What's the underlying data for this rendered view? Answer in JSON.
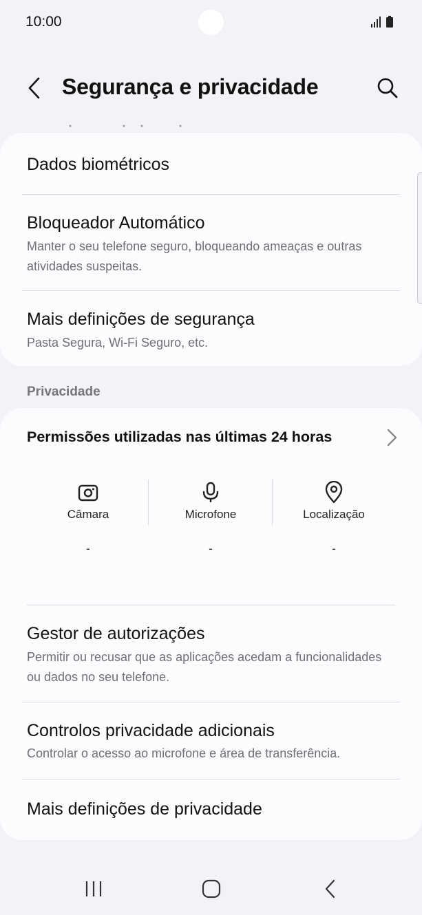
{
  "status_bar": {
    "time": "10:00"
  },
  "header": {
    "title": "Segurança e privacidade"
  },
  "security_card": {
    "items": [
      {
        "title": "Dados biométricos"
      },
      {
        "title": "Bloqueador Automático",
        "subtitle": "Manter o seu telefone seguro, bloqueando ameaças e outras atividades suspeitas."
      },
      {
        "title": "Mais definições de segurança",
        "subtitle": "Pasta Segura, Wi-Fi Seguro, etc."
      }
    ]
  },
  "privacy": {
    "section_label": "Privacidade",
    "permissions_title": "Permissões utilizadas nas últimas 24 horas",
    "permissions": [
      {
        "label": "Câmara",
        "icon": "camera-icon",
        "value": "-"
      },
      {
        "label": "Microfone",
        "icon": "microphone-icon",
        "value": "-"
      },
      {
        "label": "Localização",
        "icon": "location-pin-icon",
        "value": "-"
      }
    ],
    "items": [
      {
        "title": "Gestor de autorizações",
        "subtitle": "Permitir ou recusar que as aplicações acedam a funcionalidades ou dados no seu telefone."
      },
      {
        "title": "Controlos privacidade adicionais",
        "subtitle": "Controlar o acesso ao microfone e área de transferência."
      },
      {
        "title": "Mais definições de privacidade"
      }
    ]
  },
  "colors": {
    "background": "#f3f3f7",
    "card": "#fcfcff",
    "subtitle": "#707074",
    "divider": "#dcdce0"
  }
}
